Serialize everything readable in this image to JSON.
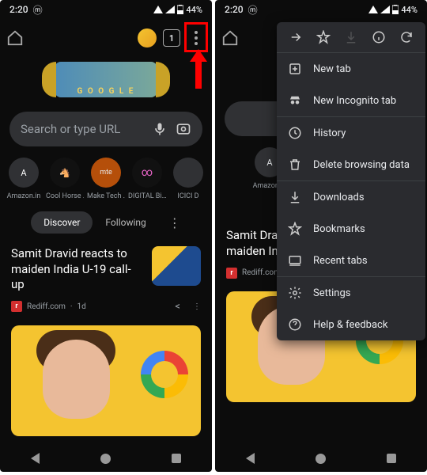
{
  "status": {
    "time": "2:20",
    "battery": "44%"
  },
  "toolbar": {
    "tabs": "1"
  },
  "search": {
    "placeholder": "Search or type URL"
  },
  "shortcuts": [
    {
      "label": "Amazon.in",
      "glyph": "A",
      "bg": "#353535",
      "fg": "#fff"
    },
    {
      "label": "Cool Horse …",
      "glyph": "🐴",
      "bg": "#111",
      "fg": "#fff"
    },
    {
      "label": "Make Tech …",
      "glyph": "mte",
      "bg": "#b54f0a",
      "fg": "#fff"
    },
    {
      "label": "DIGITAL Bi…",
      "glyph": "∞",
      "bg": "#111",
      "fg": "#f0c"
    },
    {
      "label": "ICICI D",
      "glyph": "",
      "bg": "#353535",
      "fg": "#fff"
    }
  ],
  "tabs": {
    "discover": "Discover",
    "following": "Following"
  },
  "doodle": "G O O G L E",
  "article": {
    "title_l1": "Samit Dravid reacts to",
    "title_l2": "maiden India U-19 call-up",
    "title_cut_l1": "Samit Dravid re",
    "title_cut_l2": "maiden India U",
    "source": "Rediff.com",
    "age": "1d"
  },
  "menu": {
    "newtab": "New tab",
    "incog": "New Incognito tab",
    "history": "History",
    "delete": "Delete browsing data",
    "downloads": "Downloads",
    "bookmarks": "Bookmarks",
    "recent": "Recent tabs",
    "settings": "Settings",
    "help": "Help & feedback"
  }
}
